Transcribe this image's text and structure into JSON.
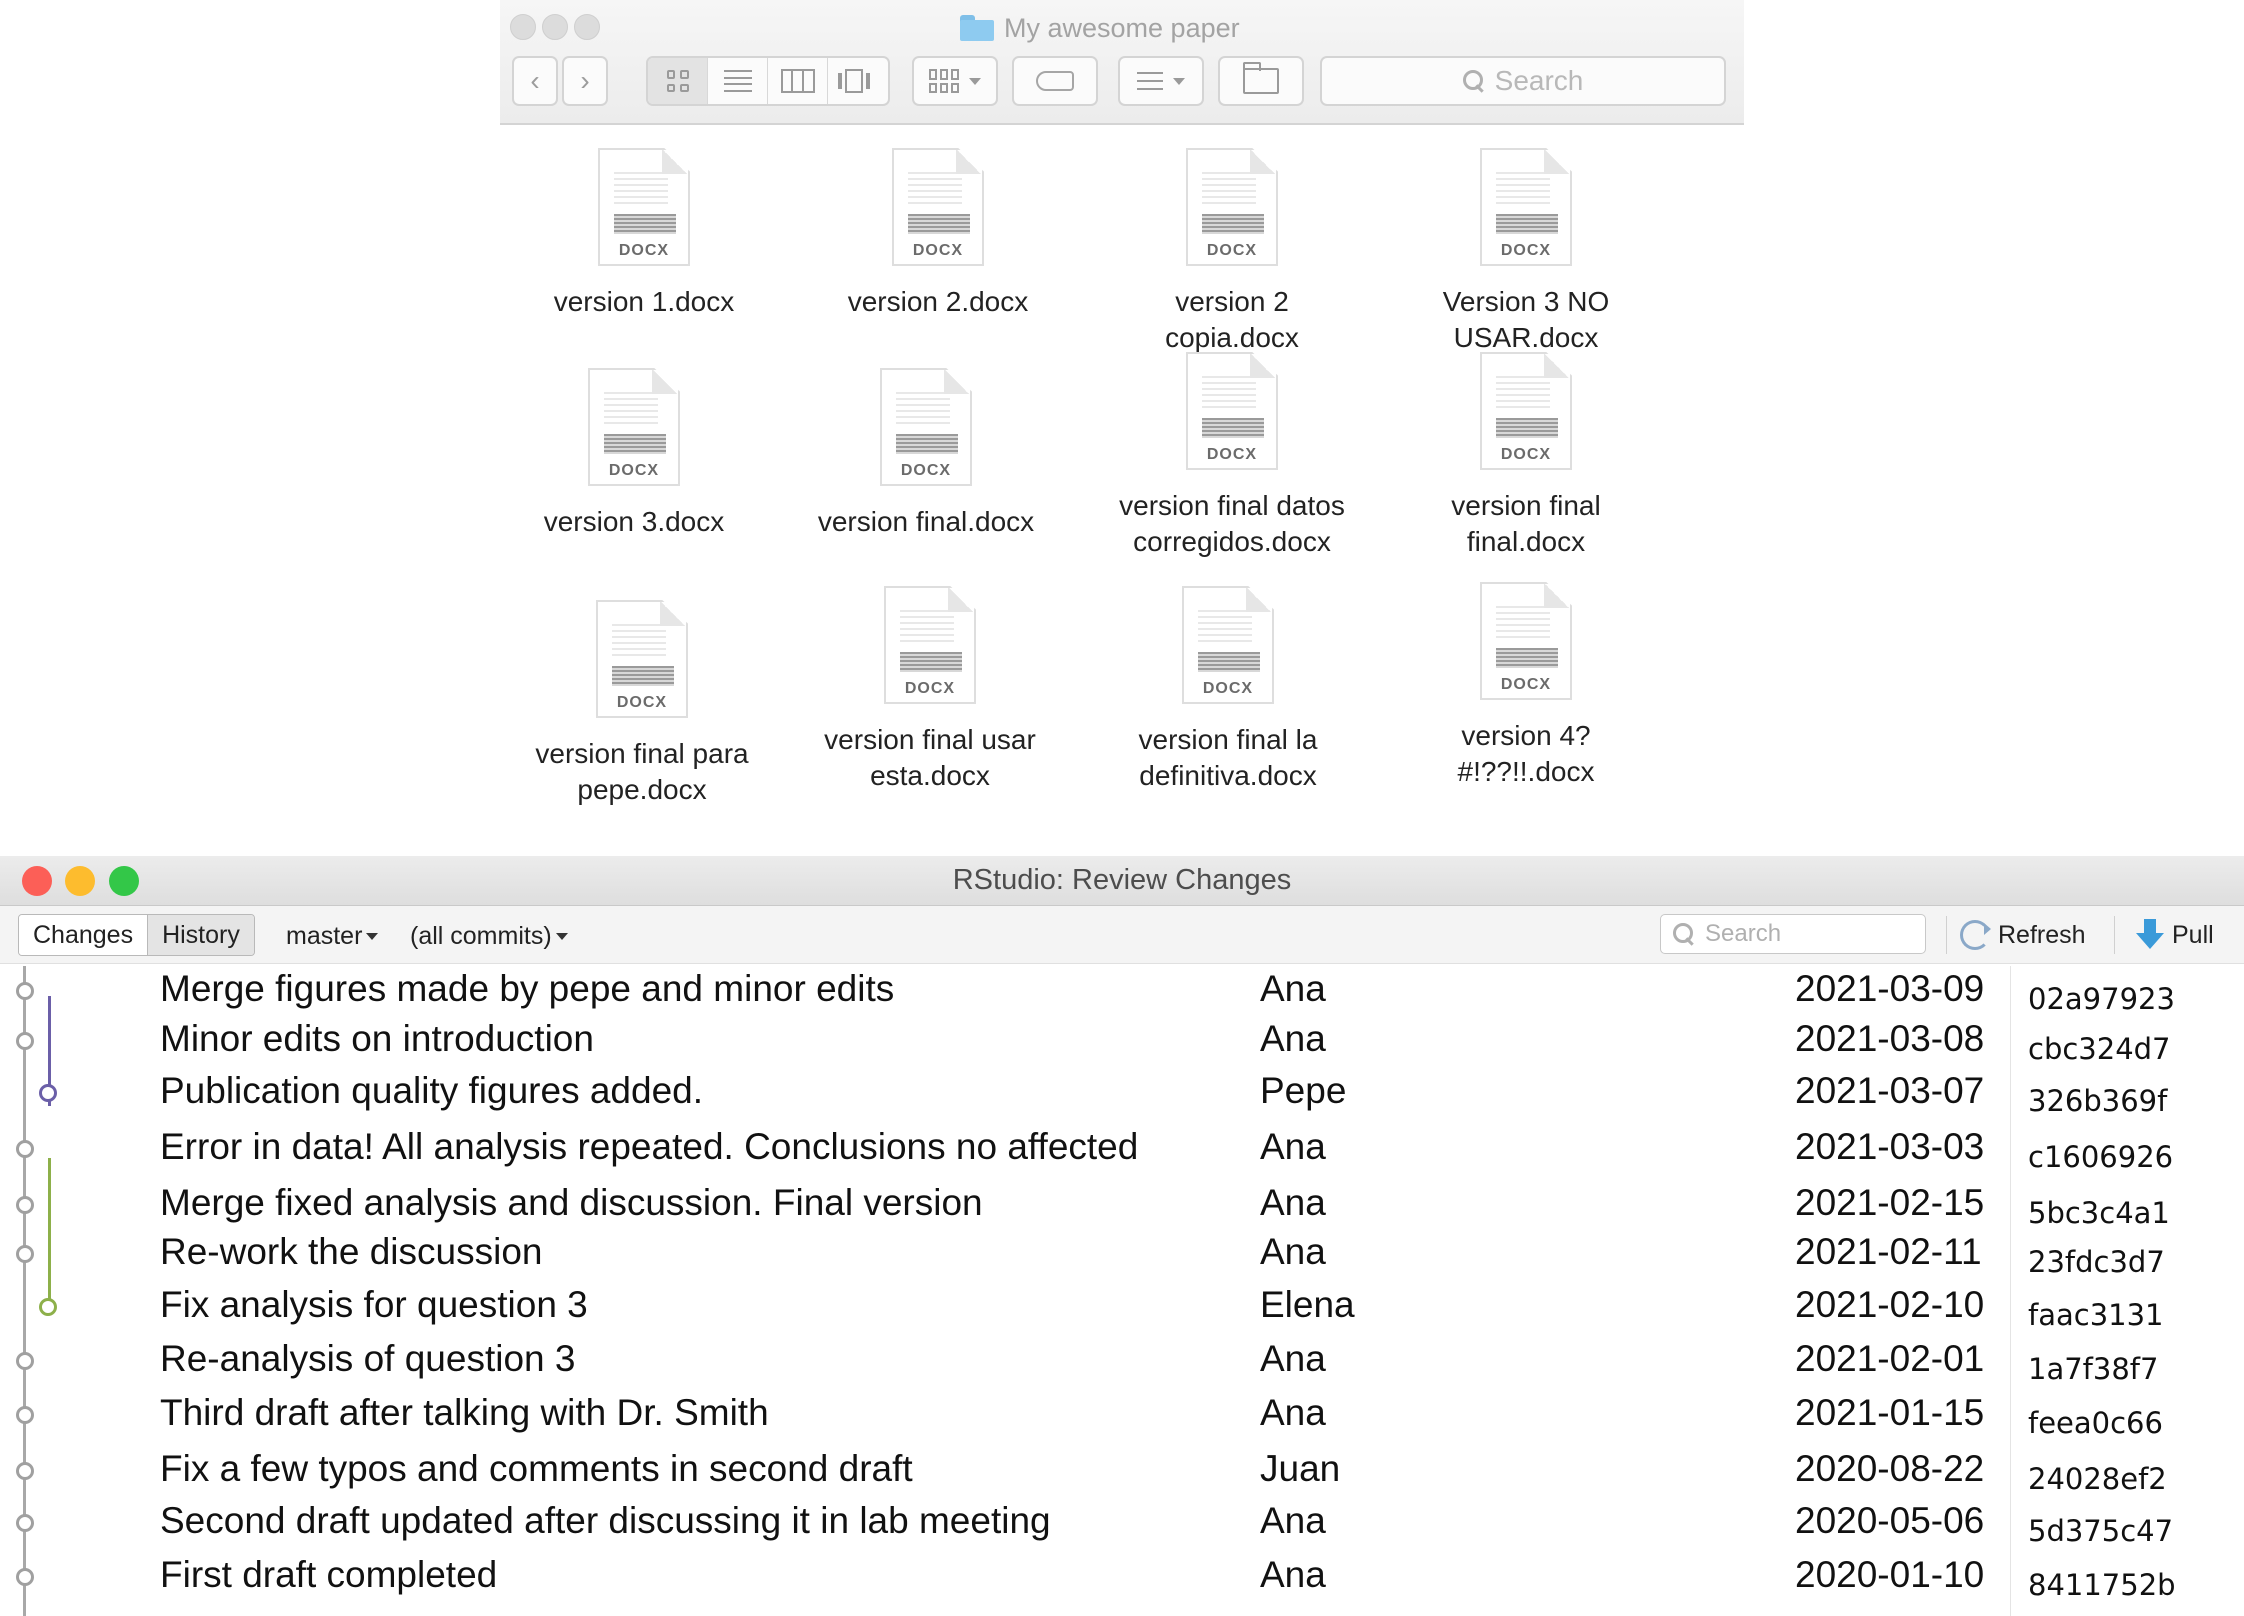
{
  "finder": {
    "title": "My awesome paper",
    "search_placeholder": "Search",
    "files": [
      {
        "name": "version 1.docx",
        "ext": "DOCX"
      },
      {
        "name": "version 2.docx",
        "ext": "DOCX"
      },
      {
        "name": "version 2 copia.docx",
        "ext": "DOCX"
      },
      {
        "name": "Version 3 NO USAR.docx",
        "ext": "DOCX"
      },
      {
        "name": "version 3.docx",
        "ext": "DOCX"
      },
      {
        "name": "version final.docx",
        "ext": "DOCX"
      },
      {
        "name": "version final datos corregidos.docx",
        "ext": "DOCX"
      },
      {
        "name": "version final final.docx",
        "ext": "DOCX"
      },
      {
        "name": "version final para pepe.docx",
        "ext": "DOCX"
      },
      {
        "name": "version final usar esta.docx",
        "ext": "DOCX"
      },
      {
        "name": "version final la definitiva.docx",
        "ext": "DOCX"
      },
      {
        "name": "version 4? #!??!!.docx",
        "ext": "DOCX"
      }
    ]
  },
  "rstudio": {
    "title": "RStudio: Review Changes",
    "traffic_colors": [
      "#fc5f57",
      "#fdbc2e",
      "#33c748"
    ],
    "tabs": [
      "Changes",
      "History"
    ],
    "branch": "master",
    "filter": "(all commits)",
    "search_placeholder": "Search",
    "refresh_label": "Refresh",
    "pull_label": "Pull",
    "branch_colors": {
      "purple": "#6b5fa8",
      "green": "#8db04a"
    },
    "commits": [
      {
        "message": "Merge figures made by pepe and minor edits",
        "author": "Ana",
        "date": "2021-03-09",
        "sha": "02a97923"
      },
      {
        "message": "Minor edits on introduction",
        "author": "Ana",
        "date": "2021-03-08",
        "sha": "cbc324d7"
      },
      {
        "message": "Publication quality figures added.",
        "author": "Pepe",
        "date": "2021-03-07",
        "sha": "326b369f"
      },
      {
        "message": "Error in data! All analysis repeated. Conclusions no affected",
        "author": "Ana",
        "date": "2021-03-03",
        "sha": "c1606926"
      },
      {
        "message": "Merge fixed analysis and discussion. Final version",
        "author": "Ana",
        "date": "2021-02-15",
        "sha": "5bc3c4a1"
      },
      {
        "message": "Re-work the discussion",
        "author": "Ana",
        "date": "2021-02-11",
        "sha": "23fdc3d7"
      },
      {
        "message": "Fix analysis for question 3",
        "author": "Elena",
        "date": "2021-02-10",
        "sha": "faac3131"
      },
      {
        "message": "Re-analysis of question 3",
        "author": "Ana",
        "date": "2021-02-01",
        "sha": "1a7f38f7"
      },
      {
        "message": "Third draft after talking with Dr. Smith",
        "author": "Ana",
        "date": "2021-01-15",
        "sha": "feea0c66"
      },
      {
        "message": "Fix a few typos and comments in second draft",
        "author": "Juan",
        "date": "2020-08-22",
        "sha": "24028ef2"
      },
      {
        "message": "Second draft updated after discussing it in lab meeting",
        "author": "Ana",
        "date": "2020-05-06",
        "sha": "5d375c47"
      },
      {
        "message": "First draft completed",
        "author": "Ana",
        "date": "2020-01-10",
        "sha": "8411752b"
      }
    ]
  }
}
